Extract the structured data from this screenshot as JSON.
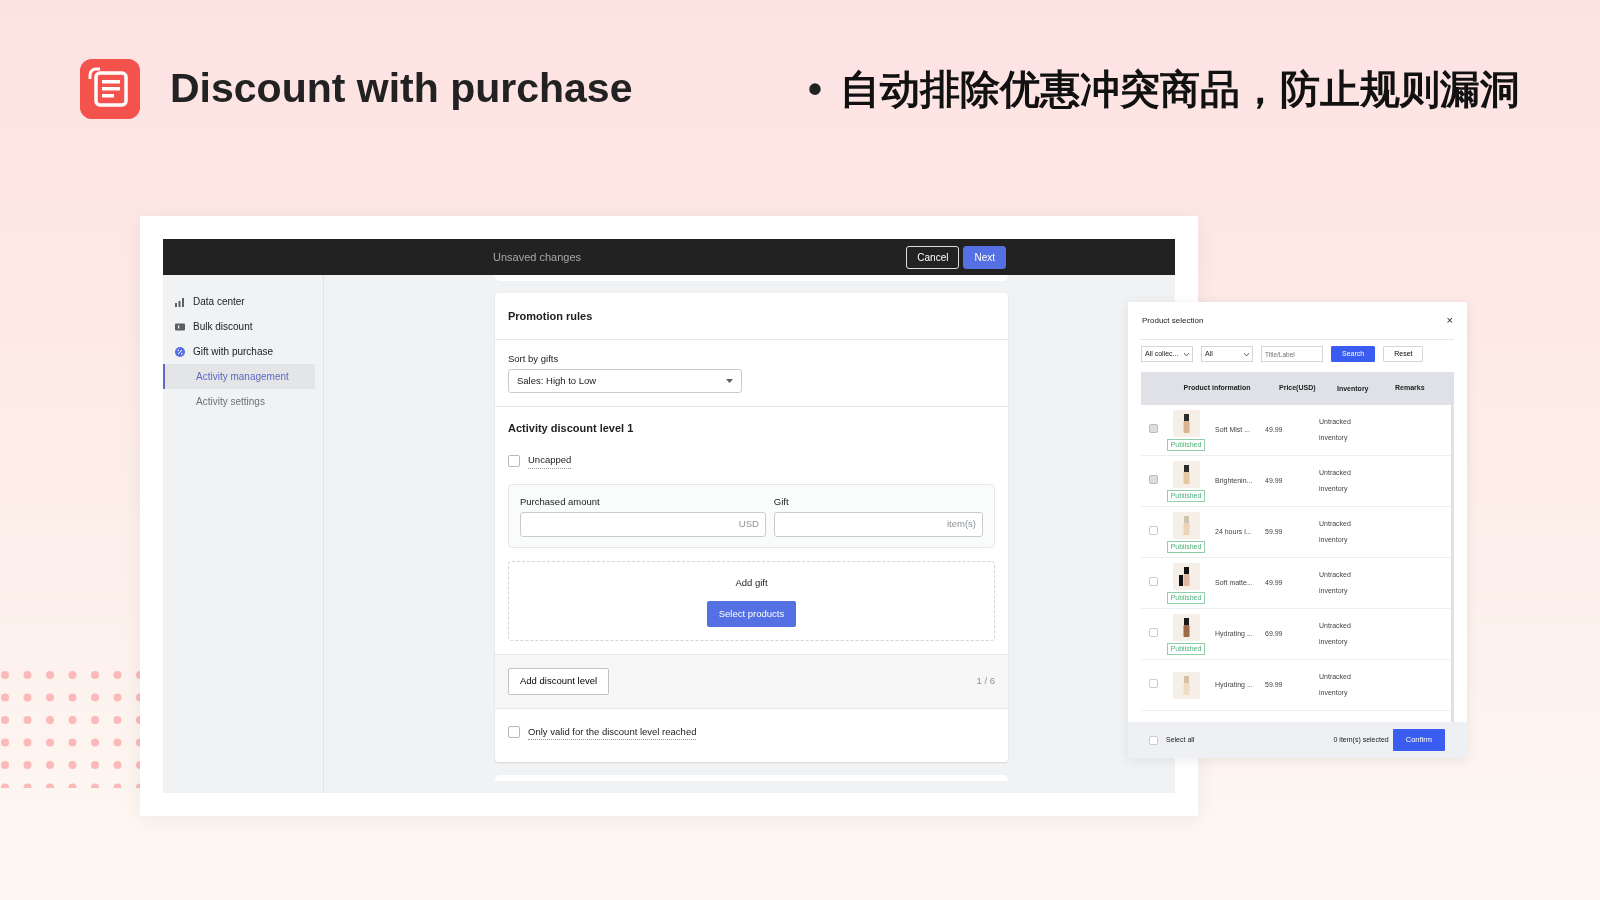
{
  "header": {
    "title": "Discount with purchase",
    "bullet": "•",
    "tagline": "自动排除优惠冲突商品，防止规则漏洞"
  },
  "topbar": {
    "status": "Unsaved changes",
    "buttons": [
      {
        "label": "Cancel",
        "kind": "outline"
      },
      {
        "label": "Next",
        "kind": "primary"
      }
    ]
  },
  "sidebar": {
    "items": [
      {
        "label": "Data center",
        "kind": "chart",
        "selected": false
      },
      {
        "label": "Bulk discount",
        "kind": "ticket",
        "selected": false
      },
      {
        "label": "Gift with purchase",
        "kind": "badge",
        "selected": false,
        "children": [
          {
            "label": "Activity management",
            "selected": true
          },
          {
            "label": "Activity settings",
            "selected": false
          }
        ]
      }
    ]
  },
  "promotion_rules": {
    "title": "Promotion rules",
    "sort_label": "Sort by gifts",
    "sort_value": "Sales: High to Low",
    "level_title": "Activity discount level 1",
    "uncapped": {
      "label": "Uncapped",
      "checked": false
    },
    "fields": [
      {
        "label": "Purchased amount",
        "unit": "USD"
      },
      {
        "label": "Gift",
        "unit": "item(s)"
      }
    ],
    "add_gift": {
      "label": "Add gift",
      "button": "Select products"
    },
    "add_level_button": "Add discount level",
    "level_count": "1 / 6",
    "only_valid": {
      "label": "Only valid for the discount level reached",
      "checked": false
    }
  },
  "product_selection": {
    "title": "Product selection",
    "close": "×",
    "filters": [
      {
        "value": "All collec..."
      },
      {
        "value": "All"
      }
    ],
    "search_placeholder": "Title/Label",
    "buttons": [
      {
        "label": "Search",
        "kind": "primary"
      },
      {
        "label": "Reset",
        "kind": "outline"
      }
    ],
    "columns": [
      "Product information",
      "Price(USD)",
      "Inventory",
      "Remarks"
    ],
    "rows": [
      {
        "name": "Soft Mist ...",
        "price": "49.99",
        "inventory": "Untracked inventory",
        "status": "Published",
        "checked": false,
        "disabled": true
      },
      {
        "name": "Brightenin...",
        "price": "49.99",
        "inventory": "Untracked inventory",
        "status": "Published",
        "checked": false,
        "disabled": true
      },
      {
        "name": "24 hours l...",
        "price": "59.99",
        "inventory": "Untracked inventory",
        "status": "Published",
        "checked": false,
        "disabled": false
      },
      {
        "name": "Soft matte...",
        "price": "49.99",
        "inventory": "Untracked inventory",
        "status": "Published",
        "checked": false,
        "disabled": false
      },
      {
        "name": "Hydrating ...",
        "price": "69.99",
        "inventory": "Untracked inventory",
        "status": "Published",
        "checked": false,
        "disabled": false
      },
      {
        "name": "Hydrating ...",
        "price": "59.99",
        "inventory": "Untracked inventory",
        "checked": false,
        "disabled": false
      }
    ],
    "footer": {
      "select_all": "Select all",
      "checked": false,
      "count": "0 item(s) selected",
      "confirm": "Confirm"
    }
  }
}
